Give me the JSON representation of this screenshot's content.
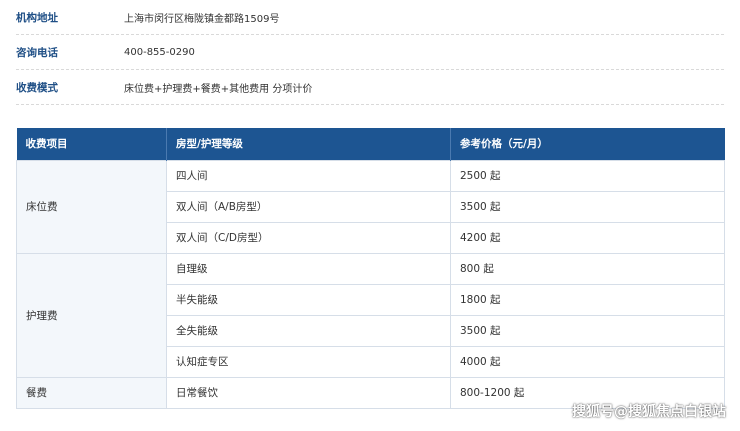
{
  "info": [
    {
      "label": "机构地址",
      "value": "上海市闵行区梅陇镇金都路1509号"
    },
    {
      "label": "咨询电话",
      "value": "400-855-0290"
    },
    {
      "label": "收费模式",
      "value": "床位费+护理费+餐费+其他费用 分项计价"
    }
  ],
  "table": {
    "headers": [
      "收费项目",
      "房型/护理等级",
      "参考价格（元/月）"
    ],
    "groups": [
      {
        "category": "床位费",
        "rows": [
          {
            "item": "四人间",
            "price": "2500 起"
          },
          {
            "item": "双人间（A/B房型）",
            "price": "3500 起"
          },
          {
            "item": "双人间（C/D房型）",
            "price": "4200 起"
          }
        ]
      },
      {
        "category": "护理费",
        "rows": [
          {
            "item": "自理级",
            "price": "800 起"
          },
          {
            "item": "半失能级",
            "price": "1800 起"
          },
          {
            "item": "全失能级",
            "price": "3500 起"
          },
          {
            "item": "认知症专区",
            "price": "4000 起"
          }
        ]
      },
      {
        "category": "餐费",
        "rows": [
          {
            "item": "日常餐饮",
            "price": "800-1200 起"
          }
        ]
      }
    ]
  },
  "watermark": "搜狐号@搜狐焦点白银站"
}
